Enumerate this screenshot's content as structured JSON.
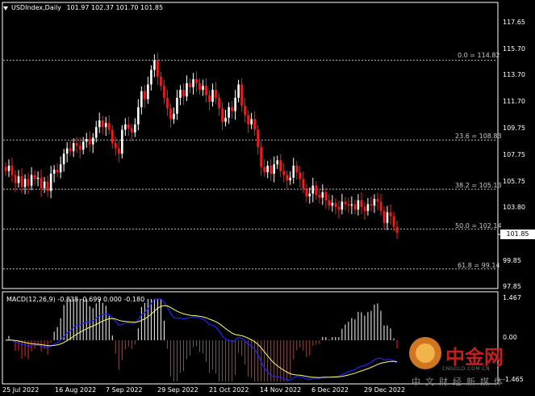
{
  "chart_header": {
    "symbol": "USDIndex,Daily",
    "ohlc": "101.97 102.37 101.70 101.85"
  },
  "current_price": "101.85",
  "price_axis": [
    "117.65",
    "115.70",
    "113.70",
    "111.70",
    "109.75",
    "107.75",
    "105.75",
    "103.80",
    "101.85",
    "99.85",
    "97.85"
  ],
  "macd": {
    "header": "MACD(12,26,9) -0.838 -0.699 0.000 -0.180",
    "axis": [
      "1.467",
      "0.00",
      "-1.465"
    ]
  },
  "date_axis": [
    "25 Jul 2022",
    "16 Aug 2022",
    "7 Sep 2022",
    "29 Sep 2022",
    "21 Oct 2022",
    "14 Nov 2022",
    "6 Dec 2022",
    "29 Dec 2022"
  ],
  "fibonacci": [
    {
      "label": "0.0 = 114.82"
    },
    {
      "label": "23.6 = 108.83"
    },
    {
      "label": "38.2 = 105.13"
    },
    {
      "label": "50.0 = 102.14"
    },
    {
      "label": "61.8 = 99.14"
    }
  ],
  "watermark": {
    "brand": "中金网",
    "site": "CNGOLD.COM.CN",
    "slogan": "中文财经新媒体"
  },
  "chart_data": {
    "type": "candlestick",
    "series": [
      {
        "name": "USDIndex,Daily",
        "type": "candlestick",
        "values": [
          106.5,
          106.9,
          106.2,
          105.6,
          106.1,
          105.3,
          105.9,
          105.4,
          106.2,
          105.9,
          106.0,
          105.2,
          105.7,
          105.0,
          106.3,
          106.6,
          106.4,
          107.0,
          107.8,
          108.2,
          108.0,
          108.6,
          108.4,
          108.1,
          108.7,
          108.9,
          108.5,
          109.0,
          109.8,
          110.3,
          109.8,
          110.1,
          109.6,
          108.6,
          108.2,
          107.8,
          109.6,
          110.0,
          109.7,
          109.4,
          110.0,
          111.3,
          112.5,
          111.9,
          113.0,
          114.1,
          114.8,
          113.6,
          112.9,
          112.0,
          111.2,
          110.4,
          110.8,
          112.0,
          112.6,
          112.1,
          113.1,
          112.8,
          113.4,
          113.1,
          112.6,
          112.9,
          112.2,
          111.7,
          112.6,
          112.0,
          111.2,
          110.2,
          110.5,
          111.3,
          111.0,
          112.0,
          113.0,
          111.4,
          110.7,
          110.0,
          110.4,
          109.6,
          108.3,
          106.8,
          106.4,
          106.9,
          106.3,
          107.0,
          107.3,
          106.5,
          106.2,
          105.8,
          106.0,
          106.9,
          106.4,
          105.9,
          105.2,
          104.6,
          104.8,
          105.4,
          104.7,
          104.5,
          104.9,
          104.3,
          103.9,
          104.1,
          103.8,
          103.6,
          104.2,
          104.0,
          103.9,
          104.0,
          103.6,
          104.3,
          103.8,
          103.5,
          104.0,
          103.9,
          104.4,
          104.2,
          103.5,
          102.6,
          103.4,
          103.1,
          102.3,
          101.85
        ]
      }
    ],
    "ylim": [
      97.85,
      117.65
    ],
    "fib_levels": [
      114.82,
      108.83,
      105.13,
      102.14,
      99.14
    ],
    "macd_ylim": [
      -1.465,
      1.467
    ]
  }
}
